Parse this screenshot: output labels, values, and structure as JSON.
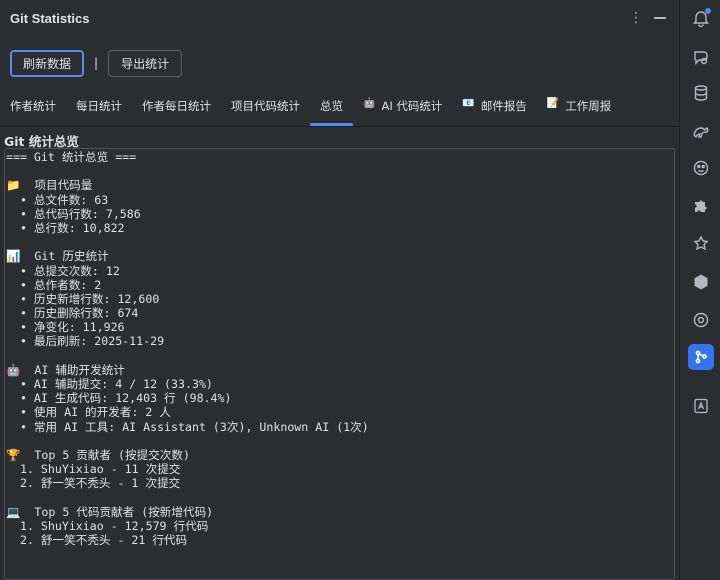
{
  "window": {
    "title": "Git Statistics"
  },
  "toolbar": {
    "refresh_label": "刷新数据",
    "separator": "|",
    "export_label": "导出统计"
  },
  "tabs": [
    {
      "icon": "",
      "label": "作者统计"
    },
    {
      "icon": "",
      "label": "每日统计"
    },
    {
      "icon": "",
      "label": "作者每日统计"
    },
    {
      "icon": "",
      "label": "项目代码统计"
    },
    {
      "icon": "",
      "label": "总览"
    },
    {
      "icon": "🤖",
      "label": "AI 代码统计"
    },
    {
      "icon": "📧",
      "label": "邮件报告"
    },
    {
      "icon": "📝",
      "label": "工作周报"
    }
  ],
  "active_tab": "总览",
  "section_title": "Git 统计总览",
  "report_lines": [
    "=== Git 统计总览 ===",
    "",
    "📁  项目代码量",
    "  • 总文件数: 63",
    "  • 总代码行数: 7,586",
    "  • 总行数: 10,822",
    "",
    "📊  Git 历史统计",
    "  • 总提交次数: 12",
    "  • 总作者数: 2",
    "  • 历史新增行数: 12,600",
    "  • 历史删除行数: 674",
    "  • 净变化: 11,926",
    "  • 最后刷新: 2025-11-29",
    "",
    "🤖  AI 辅助开发统计",
    "  • AI 辅助提交: 4 / 12 (33.3%)",
    "  • AI 生成代码: 12,403 行 (98.4%)",
    "  • 使用 AI 的开发者: 2 人",
    "  • 常用 AI 工具: AI Assistant (3次), Unknown AI (1次)",
    "",
    "🏆  Top 5 贡献者 (按提交次数)",
    "  1. ShuYixiao - 11 次提交",
    "  2. 舒一笑不秃头 - 1 次提交",
    "",
    "💻  Top 5 代码贡献者 (按新增代码)",
    "  1. ShuYixiao - 12,579 行代码",
    "  2. 舒一笑不秃头 - 21 行代码"
  ],
  "sidebar_icons": [
    "notifications-icon",
    "ai-chat-icon",
    "database-icon",
    "gradle-icon",
    "plugin-face-icon",
    "puzzle-icon",
    "settings-spark-icon",
    "hexagon-icon",
    "target-icon",
    "git-statistics-icon",
    "translate-icon"
  ],
  "colors": {
    "accent": "#548af7",
    "active_side": "#3574f0",
    "background": "#2b2d30"
  }
}
